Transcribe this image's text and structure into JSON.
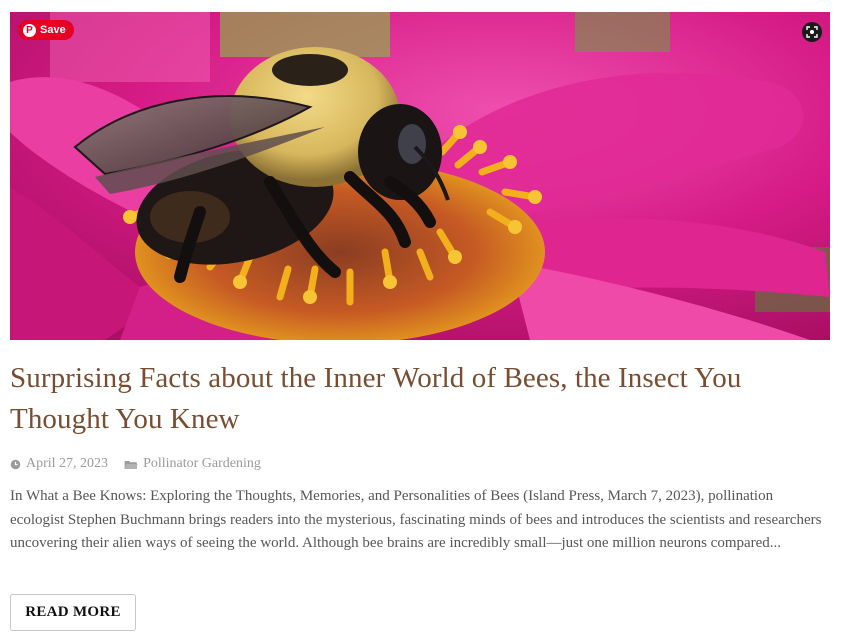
{
  "post": {
    "image_alt": "Bumblebee on a pink zinnia flower",
    "pin_save_label": "Save",
    "title": "Surprising Facts about the Inner World of Bees, the Insect You Thought You Knew",
    "date": "April 27, 2023",
    "category": "Pollinator Gardening",
    "excerpt": "In What a Bee Knows: Exploring the Thoughts, Memories, and Personalities of Bees (Island Press, March 7, 2023), pollination ecologist Stephen Buchmann brings readers into the mysterious, fascinating minds of bees and introduces the scientists and researchers uncovering their alien ways of seeing the world. Although bee brains are incredibly small—just one million neurons compared...",
    "read_more_label": "READ MORE"
  },
  "icons": {
    "pin": "pinterest-icon",
    "lens": "visual-search-icon",
    "date": "clock-icon",
    "category": "folder-icon"
  },
  "colors": {
    "title": "#7a4d31",
    "meta": "#9b9b9b",
    "excerpt": "#575757",
    "pinterest": "#e60023",
    "flower": "#d61e8a"
  }
}
